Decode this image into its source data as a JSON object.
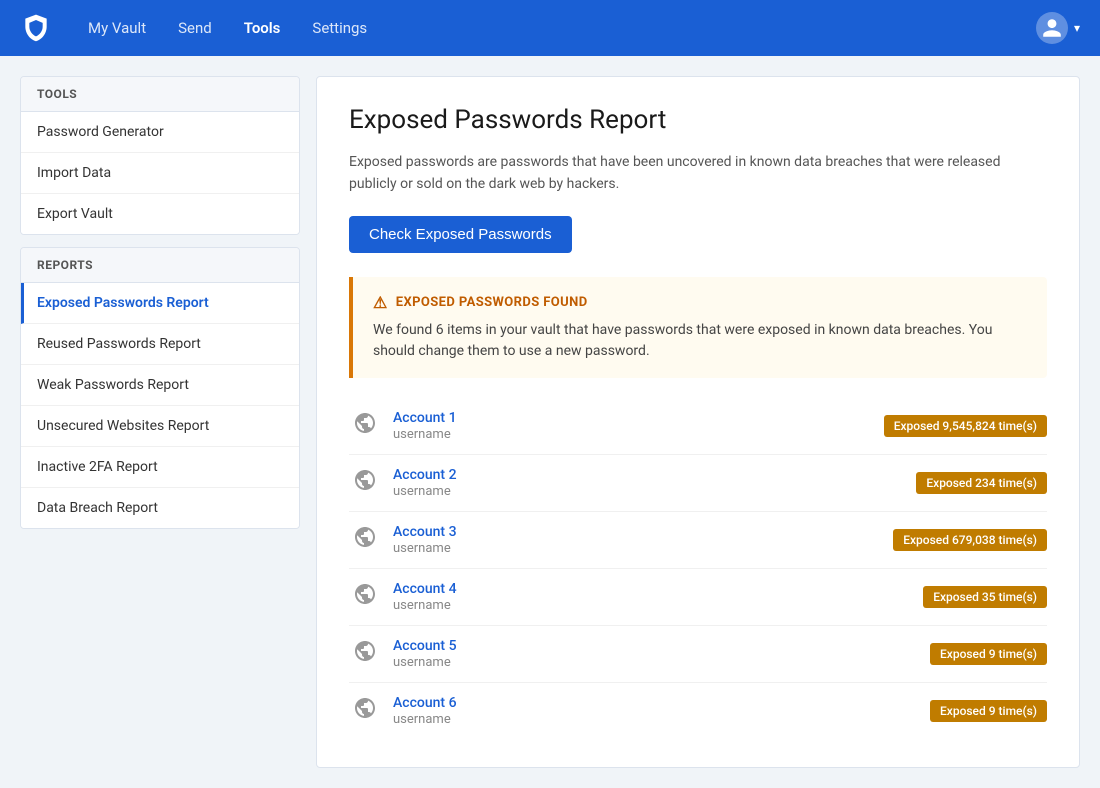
{
  "navbar": {
    "logo_alt": "Bitwarden",
    "links": [
      {
        "label": "My Vault",
        "active": false
      },
      {
        "label": "Send",
        "active": false
      },
      {
        "label": "Tools",
        "active": true
      },
      {
        "label": "Settings",
        "active": false
      }
    ],
    "user_icon": "account-circle"
  },
  "sidebar": {
    "tools_section_title": "TOOLS",
    "tools_items": [
      {
        "label": "Password Generator"
      },
      {
        "label": "Import Data"
      },
      {
        "label": "Export Vault"
      }
    ],
    "reports_section_title": "REPORTS",
    "reports_items": [
      {
        "label": "Exposed Passwords Report",
        "active": true
      },
      {
        "label": "Reused Passwords Report",
        "active": false
      },
      {
        "label": "Weak Passwords Report",
        "active": false
      },
      {
        "label": "Unsecured Websites Report",
        "active": false
      },
      {
        "label": "Inactive 2FA Report",
        "active": false
      },
      {
        "label": "Data Breach Report",
        "active": false
      }
    ]
  },
  "main": {
    "title": "Exposed Passwords Report",
    "description": "Exposed passwords are passwords that have been uncovered in known data breaches that were released publicly or sold on the dark web by hackers.",
    "check_button_label": "Check Exposed Passwords",
    "alert": {
      "icon": "⚠",
      "title": "EXPOSED PASSWORDS FOUND",
      "text": "We found 6 items in your vault that have passwords that were exposed in known data breaches. You should change them to use a new password."
    },
    "accounts": [
      {
        "name": "Account 1",
        "username": "username",
        "badge": "Exposed 9,545,824 time(s)"
      },
      {
        "name": "Account 2",
        "username": "username",
        "badge": "Exposed 234 time(s)"
      },
      {
        "name": "Account 3",
        "username": "username",
        "badge": "Exposed 679,038 time(s)"
      },
      {
        "name": "Account 4",
        "username": "username",
        "badge": "Exposed 35 time(s)"
      },
      {
        "name": "Account 5",
        "username": "username",
        "badge": "Exposed 9 time(s)"
      },
      {
        "name": "Account 6",
        "username": "username",
        "badge": "Exposed 9 time(s)"
      }
    ]
  }
}
